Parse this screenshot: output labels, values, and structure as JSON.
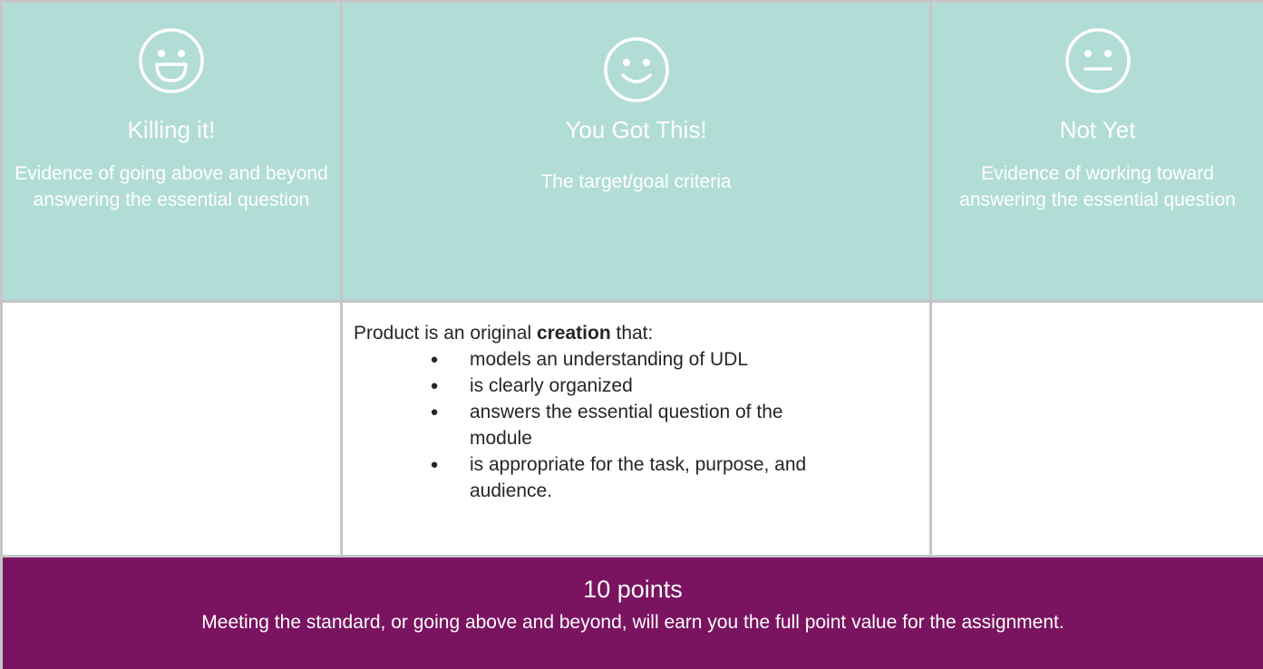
{
  "levels": [
    {
      "icon": "grinning-face-icon",
      "title": "Killing it!",
      "description": "Evidence of going above and beyond answering the essential question"
    },
    {
      "icon": "smiling-face-icon",
      "title": "You Got This!",
      "description": "The target/goal criteria"
    },
    {
      "icon": "neutral-face-icon",
      "title": "Not Yet",
      "description": "Evidence of working toward answering the essential question"
    }
  ],
  "criteria": {
    "intro_prefix": "Product is an original ",
    "intro_bold": "creation",
    "intro_suffix": " that:",
    "bullet": "●",
    "items": [
      "models an understanding of UDL",
      "is clearly organized",
      "answers the essential question of the module",
      "is appropriate for the task, purpose, and audience."
    ]
  },
  "footer": {
    "points": "10 points",
    "note": "Meeting the standard, or going above and beyond, will earn you the full point value for the assignment."
  },
  "colors": {
    "header_bg": "#b2ddd6",
    "footer_bg": "#7a1360",
    "border": "#c6c6c6"
  }
}
